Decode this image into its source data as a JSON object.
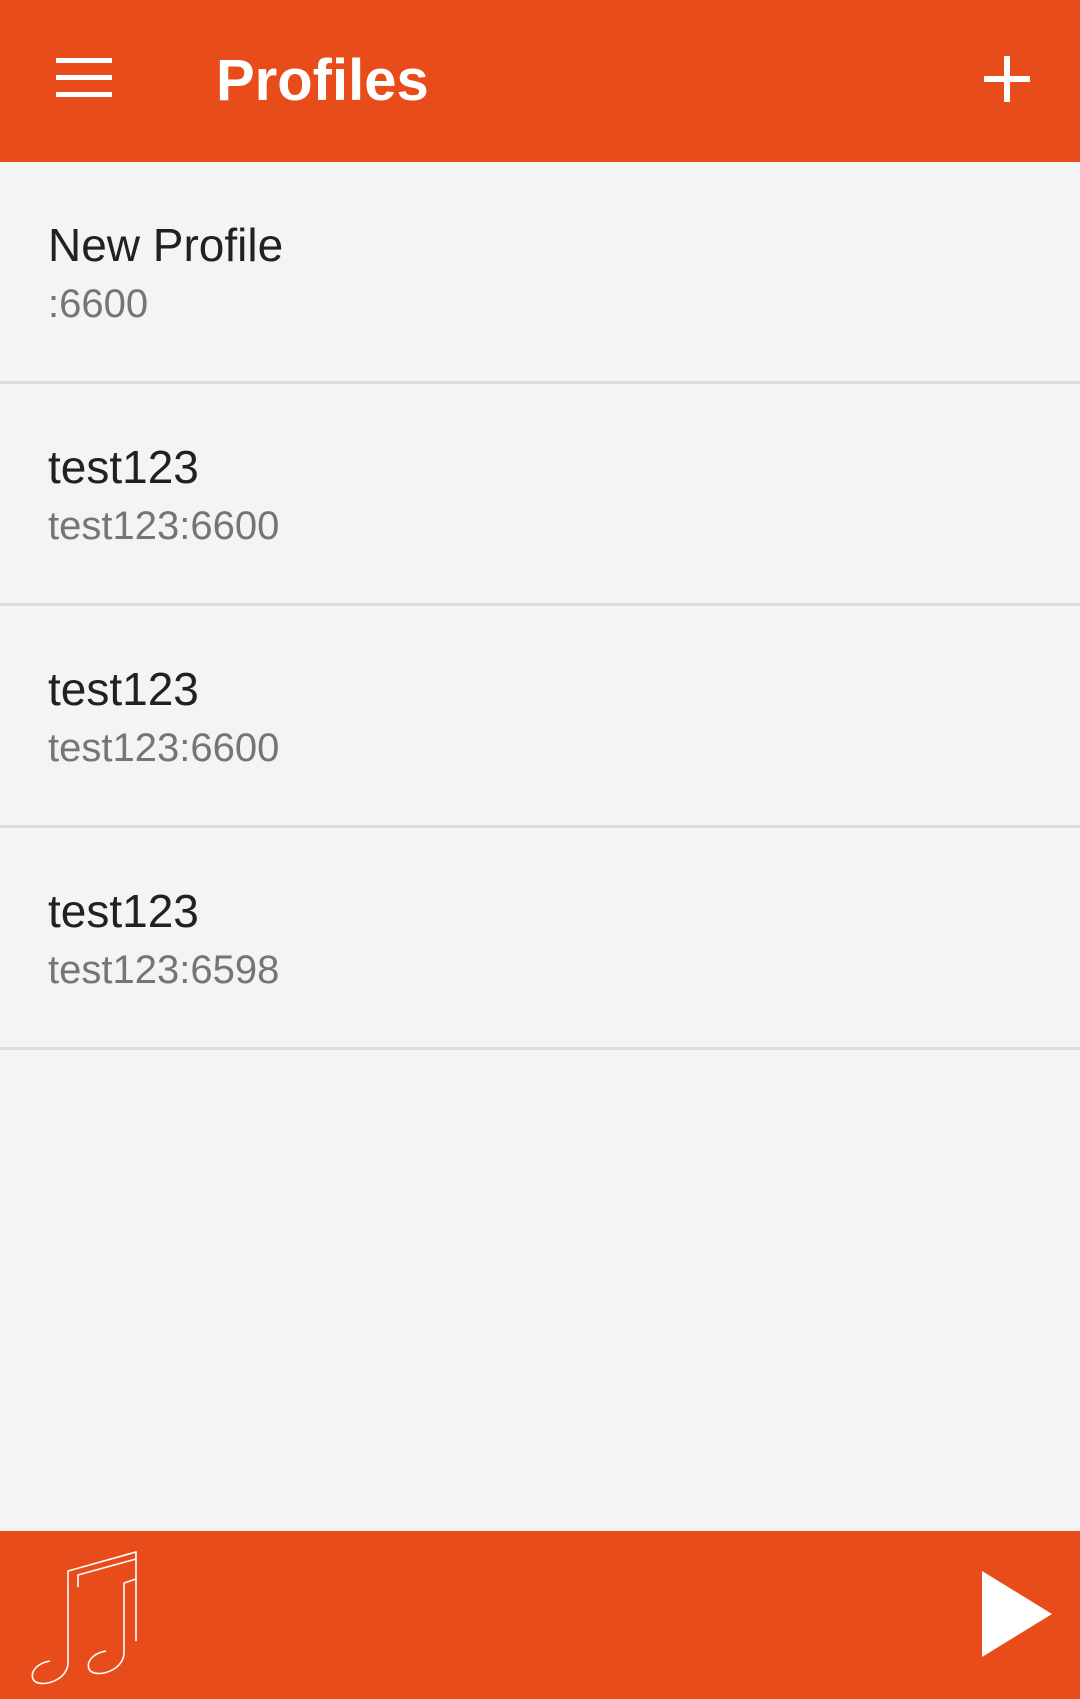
{
  "header": {
    "menu_icon": "hamburger-menu-icon",
    "title": "Profiles",
    "add_icon": "plus-icon"
  },
  "profiles": [
    {
      "name": "New Profile",
      "address": ":6600"
    },
    {
      "name": "test123",
      "address": "test123:6600"
    },
    {
      "name": "test123",
      "address": "test123:6600"
    },
    {
      "name": "test123",
      "address": "test123:6598"
    }
  ],
  "player_bar": {
    "music_icon": "music-note-icon",
    "play_icon": "play-icon"
  },
  "colors": {
    "accent": "#e84c1a",
    "background": "#f4f4f4",
    "primary_text": "#212121",
    "secondary_text": "#757575"
  }
}
